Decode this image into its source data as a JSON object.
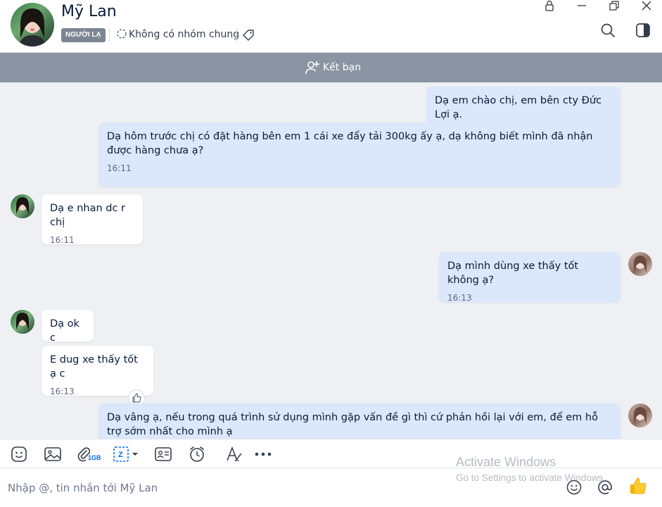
{
  "header": {
    "contact_name": "Mỹ Lan",
    "stranger_badge": "NGƯỜI LẠ",
    "mutual_groups": "Không có nhóm chung"
  },
  "friend_bar": {
    "label": "Kết bạn"
  },
  "messages": [
    {
      "dir": "out",
      "text": "Dạ em chào chị, em bên cty Đức Lợi ạ.",
      "time": ""
    },
    {
      "dir": "out",
      "text": "Dạ hôm trước chị có đặt hàng bên em 1 cái xe đẩy tải 300kg ấy ạ, dạ không biết mình đã nhận được hàng chưa ạ?",
      "time": "16:11"
    },
    {
      "dir": "in",
      "text": "Dạ e nhan dc r chị",
      "time": "16:11"
    },
    {
      "dir": "out",
      "text": "Dạ mình dùng xe thấy tốt không ạ?",
      "time": "16:13"
    },
    {
      "dir": "in",
      "text": "Dạ ok c",
      "time": ""
    },
    {
      "dir": "in",
      "text": "E dug xe thấy tốt ạ c",
      "time": "16:13"
    },
    {
      "dir": "out",
      "text": "Dạ vâng ạ, nếu trong quá trình sử dụng mình gặp vấn đề gì thì cứ phản hồi lại với em, để em hỗ trợ sớm nhất cho mình ạ",
      "time": ""
    }
  ],
  "toolbar": {
    "file_size_label": "1GB",
    "icons": [
      "sticker-icon",
      "image-icon",
      "attachment-icon",
      "screenshot-icon",
      "contact-card-icon",
      "reminder-icon",
      "text-format-icon",
      "more-icon"
    ]
  },
  "composer": {
    "placeholder": "Nhập @, tin nhắn tới Mỹ Lan"
  },
  "watermark": {
    "line1": "Activate Windows",
    "line2": "Go to Settings to activate Windows."
  },
  "colors": {
    "accent": "#0068ff",
    "outgoing_bubble": "#dbe7fb",
    "incoming_bubble": "#ffffff",
    "friend_bar": "#8a94a3",
    "chat_bg": "#eef0f3"
  }
}
